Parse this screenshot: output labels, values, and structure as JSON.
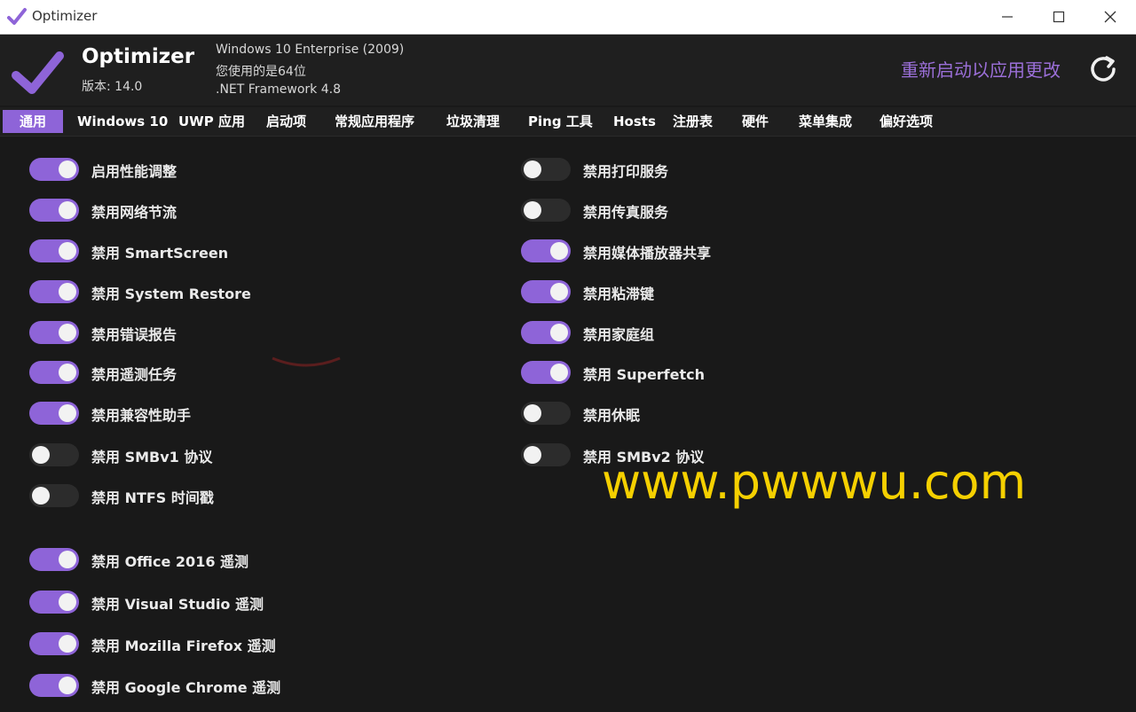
{
  "window": {
    "title": "Optimizer"
  },
  "header": {
    "app_name": "Optimizer",
    "version": "版本: 14.0",
    "os": "Windows 10 Enterprise (2009)",
    "arch": "您使用的是64位",
    "framework": ".NET Framework 4.8",
    "restart": "重新启动以应用更改"
  },
  "tabs": [
    {
      "label": "通用",
      "active": true
    },
    {
      "label": "Windows 10"
    },
    {
      "label": "UWP 应用"
    },
    {
      "label": "启动项"
    },
    {
      "label": "常规应用程序"
    },
    {
      "label": "垃圾清理"
    },
    {
      "label": "Ping 工具"
    },
    {
      "label": "Hosts"
    },
    {
      "label": "注册表"
    },
    {
      "label": "硬件"
    },
    {
      "label": "菜单集成"
    },
    {
      "label": "偏好选项"
    }
  ],
  "left_options": [
    {
      "label": "启用性能调整",
      "on": true
    },
    {
      "label": "禁用网络节流",
      "on": true
    },
    {
      "label": "禁用 SmartScreen",
      "on": true
    },
    {
      "label": "禁用 System Restore",
      "on": true
    },
    {
      "label": "禁用错误报告",
      "on": true
    },
    {
      "label": "禁用遥测任务",
      "on": true
    },
    {
      "label": "禁用兼容性助手",
      "on": true
    },
    {
      "label": "禁用 SMBv1 协议",
      "on": false
    },
    {
      "label": "禁用 NTFS 时间戳",
      "on": false
    }
  ],
  "right_options": [
    {
      "label": "禁用打印服务",
      "on": false
    },
    {
      "label": "禁用传真服务",
      "on": false
    },
    {
      "label": "禁用媒体播放器共享",
      "on": true
    },
    {
      "label": "禁用粘滞键",
      "on": true
    },
    {
      "label": "禁用家庭组",
      "on": true
    },
    {
      "label": "禁用 Superfetch",
      "on": true
    },
    {
      "label": "禁用休眠",
      "on": false
    },
    {
      "label": "禁用 SMBv2 协议",
      "on": false
    }
  ],
  "telemetry_options": [
    {
      "label": "禁用 Office 2016 遥测",
      "on": true
    },
    {
      "label": "禁用 Visual Studio 遥测",
      "on": true
    },
    {
      "label": "禁用 Mozilla Firefox 遥测",
      "on": true
    },
    {
      "label": "禁用 Google Chrome 遥测",
      "on": true
    }
  ],
  "overlay": {
    "url": "www.pwwwu.com"
  },
  "colors": {
    "accent": "#8e64d8",
    "restart": "#9b6fd8",
    "background": "#191919",
    "watermark_url": "#f5d000"
  },
  "icons": {
    "logo": "checkmark-icon",
    "refresh": "refresh-icon",
    "minimize": "minimize-icon",
    "maximize": "maximize-icon",
    "close": "close-icon"
  }
}
